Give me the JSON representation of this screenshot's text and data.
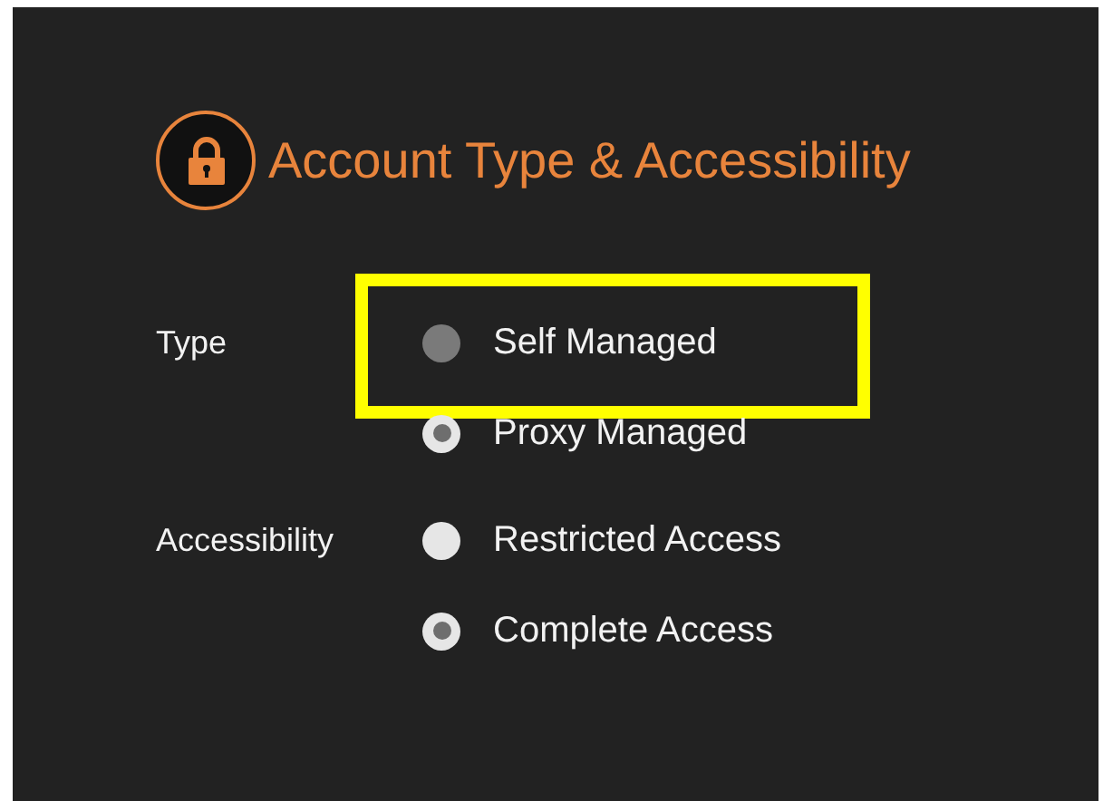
{
  "section": {
    "title": "Account Type & Accessibility"
  },
  "groups": [
    {
      "label": "Type",
      "options": [
        {
          "label": "Self Managed",
          "selected": false,
          "disabled": true,
          "highlighted": true
        },
        {
          "label": "Proxy Managed",
          "selected": true,
          "disabled": false,
          "highlighted": false
        }
      ]
    },
    {
      "label": "Accessibility",
      "options": [
        {
          "label": "Restricted Access",
          "selected": false,
          "disabled": false,
          "highlighted": false
        },
        {
          "label": "Complete Access",
          "selected": true,
          "disabled": false,
          "highlighted": false
        }
      ]
    }
  ]
}
